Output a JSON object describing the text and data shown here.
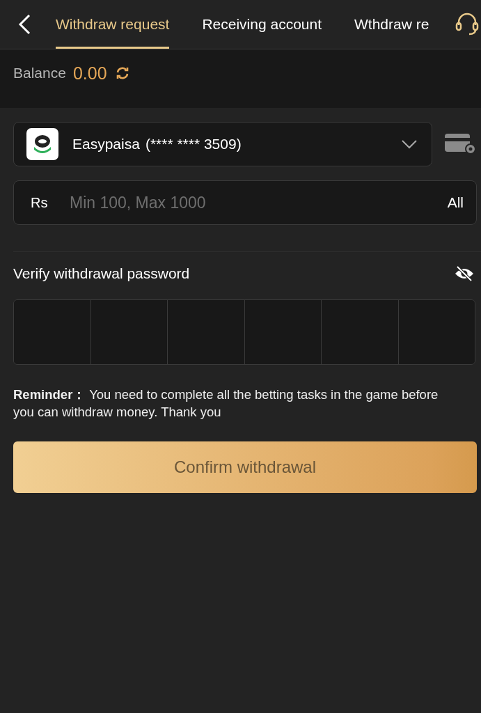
{
  "tabs": [
    {
      "label": "Withdraw request",
      "selected": true
    },
    {
      "label": "Receiving account",
      "selected": false
    },
    {
      "label": "Wthdraw re",
      "selected": false
    }
  ],
  "balance": {
    "label": "Balance",
    "amount": "0.00"
  },
  "account": {
    "name": "Easypaisa",
    "number": "(**** **** 3509)"
  },
  "amount": {
    "currency": "Rs",
    "placeholder": "Min 100, Max 1000",
    "all_button": "All"
  },
  "password": {
    "label": "Verify withdrawal password",
    "cells": [
      {
        "filled": false
      },
      {
        "filled": false
      },
      {
        "filled": false
      },
      {
        "filled": false
      },
      {
        "filled": false
      },
      {
        "filled": false
      }
    ]
  },
  "reminder": "**Reminder：** You need to complete all the betting tasks in the game before you can withdraw money. Thank you",
  "confirm_button": {
    "label": "Confirm withdrawal",
    "disabled": true
  }
}
